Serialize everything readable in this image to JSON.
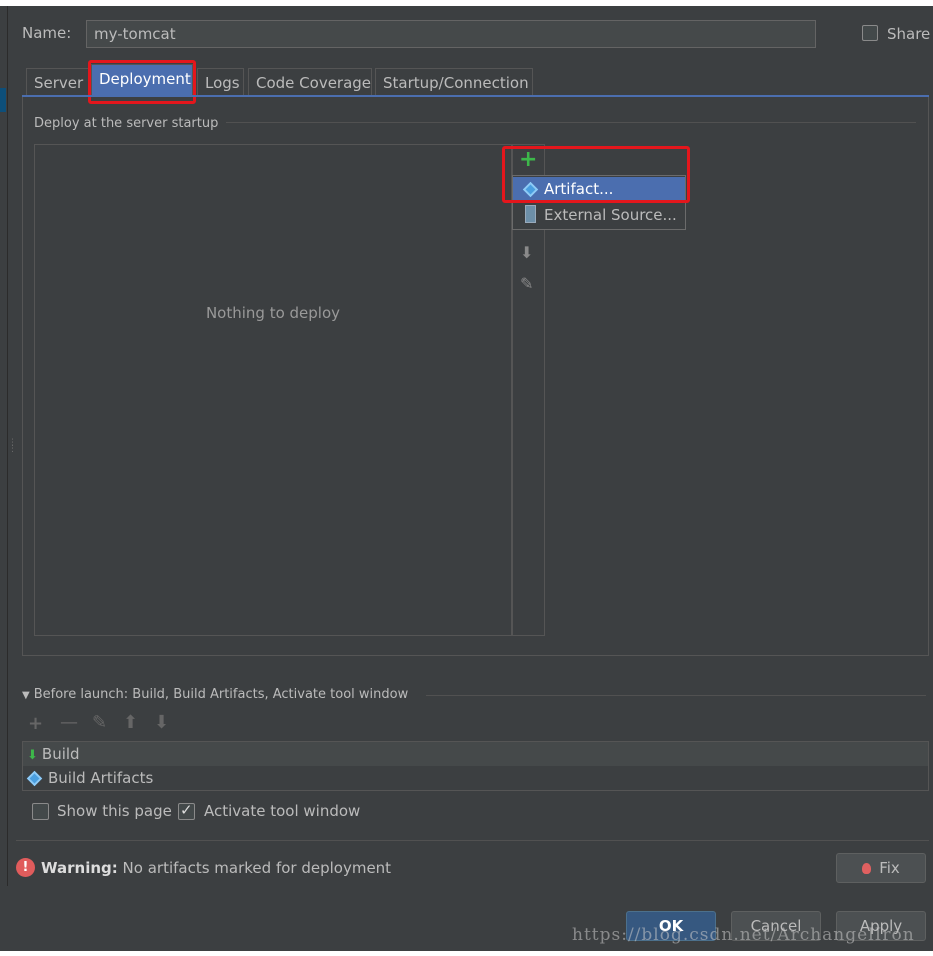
{
  "header": {
    "name_label": "Name:",
    "name_value": "my-tomcat",
    "share_label": "Share"
  },
  "tabs": [
    {
      "label": "Server"
    },
    {
      "label": "Deployment"
    },
    {
      "label": "Logs"
    },
    {
      "label": "Code Coverage"
    },
    {
      "label": "Startup/Connection"
    }
  ],
  "deployment": {
    "section_title": "Deploy at the server startup",
    "empty_text": "Nothing to deploy",
    "add_menu": [
      {
        "label": "Artifact...",
        "icon": "artifact-icon"
      },
      {
        "label": "External Source...",
        "icon": "archive-icon"
      }
    ]
  },
  "before_launch": {
    "title": "Before launch: Build, Build Artifacts, Activate tool window",
    "items": [
      {
        "label": "Build",
        "icon": "build-icon"
      },
      {
        "label": "Build Artifacts",
        "icon": "artifact-icon"
      }
    ],
    "show_page_label": "Show this page",
    "show_page_checked": false,
    "activate_tool_label": "Activate tool window",
    "activate_tool_checked": true
  },
  "warning": {
    "bold": "Warning:",
    "text": "No artifacts marked for deployment",
    "fix_label": "Fix"
  },
  "footer": {
    "ok_label": "OK",
    "cancel_label": "Cancel",
    "apply_label": "Apply"
  },
  "watermark": "https://blog.csdn.net/ArchangelIron",
  "colors": {
    "background": "#3c3f41",
    "selection": "#4b6eaf",
    "add_green": "#3db84a",
    "highlight_red": "#e4161c"
  }
}
